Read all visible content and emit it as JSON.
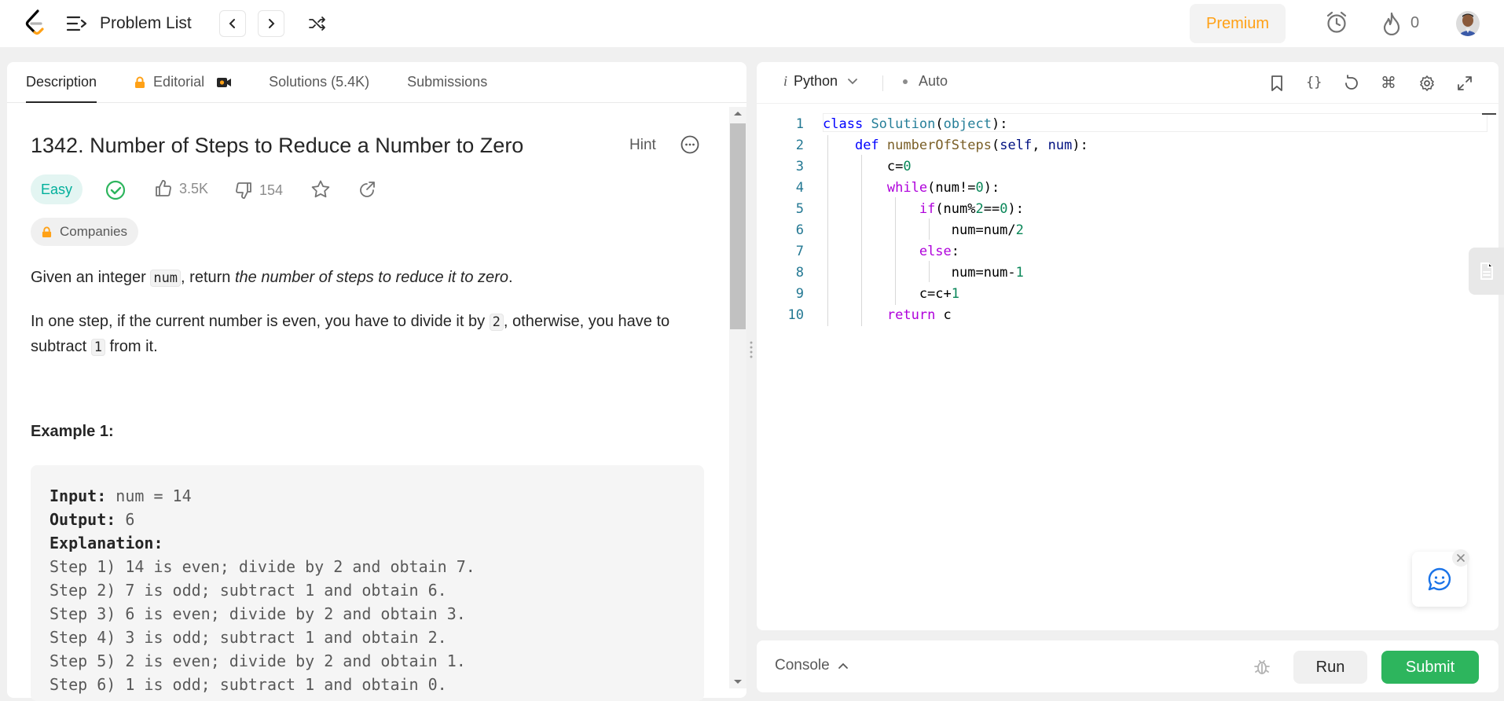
{
  "topbar": {
    "problem_list_label": "Problem List",
    "premium_label": "Premium",
    "streak_count": "0"
  },
  "left_panel": {
    "tabs": [
      {
        "label": "Description",
        "active": true
      },
      {
        "label": "Editorial",
        "locked": true
      },
      {
        "label": "Solutions (5.4K)"
      },
      {
        "label": "Submissions"
      }
    ],
    "problem": {
      "title": "1342. Number of Steps to Reduce a Number to Zero",
      "hint_label": "Hint",
      "difficulty": "Easy",
      "likes": "3.5K",
      "dislikes": "154",
      "companies_label": "Companies",
      "desc_p1_pre": "Given an integer ",
      "desc_p1_code": "num",
      "desc_p1_mid": ", return ",
      "desc_p1_em": "the number of steps to reduce it to zero",
      "desc_p1_end": ".",
      "desc_p2_pre": "In one step, if the current number is even, you have to divide it by ",
      "desc_p2_code1": "2",
      "desc_p2_mid": ", otherwise, you have to subtract ",
      "desc_p2_code2": "1",
      "desc_p2_end": " from it.",
      "example_title": "Example 1:",
      "example": {
        "input_label": "Input:",
        "input_value": " num = 14",
        "output_label": "Output:",
        "output_value": " 6",
        "explanation_label": "Explanation:",
        "steps": [
          "Step 1) 14 is even; divide by 2 and obtain 7.",
          "Step 2) 7 is odd; subtract 1 and obtain 6.",
          "Step 3) 6 is even; divide by 2 and obtain 3.",
          "Step 4) 3 is odd; subtract 1 and obtain 2.",
          "Step 5) 2 is even; divide by 2 and obtain 1.",
          "Step 6) 1 is odd; subtract 1 and obtain 0."
        ]
      }
    }
  },
  "editor": {
    "language": "Python",
    "autocomplete_label": "Auto",
    "line_numbers": [
      "1",
      "2",
      "3",
      "4",
      "5",
      "6",
      "7",
      "8",
      "9",
      "10"
    ]
  },
  "console": {
    "console_label": "Console",
    "run_label": "Run",
    "submit_label": "Submit"
  },
  "colors": {
    "accent_orange": "#ffa116",
    "easy_green": "#00af9b",
    "submit_green": "#2db55d"
  }
}
